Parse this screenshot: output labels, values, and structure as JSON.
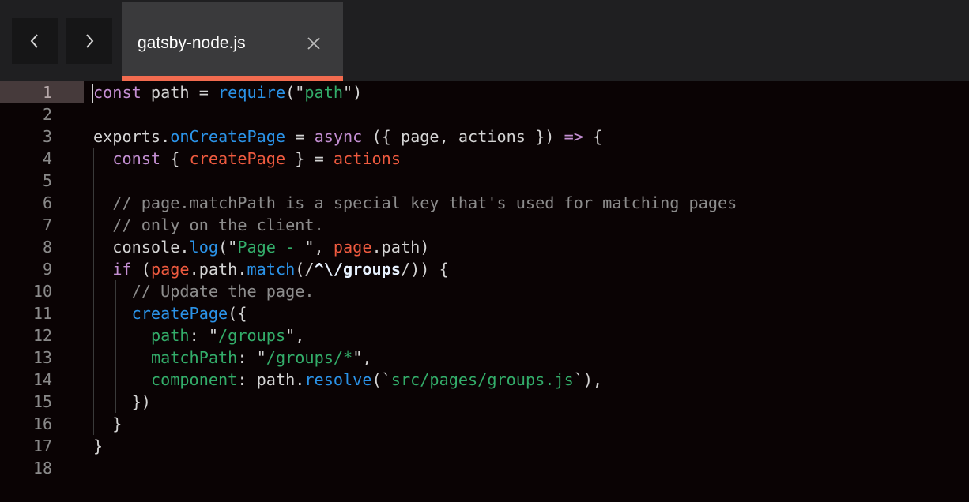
{
  "toolbar": {
    "back_icon": "chevron-left-icon",
    "forward_icon": "chevron-right-icon"
  },
  "tab": {
    "label": "gatsby-node.js",
    "close_icon": "close-icon",
    "accent_color": "#f26b4f"
  },
  "colors": {
    "keyword": "#c48fd3",
    "function": "#2b93e8",
    "string": "#33ad6a",
    "variable": "#ee5a3f",
    "comment": "#8d8d8d",
    "plain": "#d4d4d4"
  },
  "editor": {
    "current_line": 1,
    "lines": [
      {
        "num": "1",
        "tokens": [
          [
            "kw",
            "const"
          ],
          [
            "plain",
            " path = "
          ],
          [
            "fn",
            "require"
          ],
          [
            "plain",
            "(\""
          ],
          [
            "str",
            "path"
          ],
          [
            "plain",
            "\")"
          ]
        ]
      },
      {
        "num": "2",
        "tokens": []
      },
      {
        "num": "3",
        "tokens": [
          [
            "plain",
            "exports."
          ],
          [
            "fn",
            "onCreatePage"
          ],
          [
            "plain",
            " = "
          ],
          [
            "kw",
            "async"
          ],
          [
            "plain",
            " ({ page, actions }) "
          ],
          [
            "kw",
            "=>"
          ],
          [
            "plain",
            " {"
          ]
        ]
      },
      {
        "num": "4",
        "tokens": [
          [
            "plain",
            "  "
          ],
          [
            "kw",
            "const"
          ],
          [
            "plain",
            " { "
          ],
          [
            "var",
            "createPage"
          ],
          [
            "plain",
            " } = "
          ],
          [
            "var",
            "actions"
          ]
        ]
      },
      {
        "num": "5",
        "tokens": []
      },
      {
        "num": "6",
        "tokens": [
          [
            "plain",
            "  "
          ],
          [
            "cmt",
            "// page.matchPath is a special key that's used for matching pages"
          ]
        ]
      },
      {
        "num": "7",
        "tokens": [
          [
            "plain",
            "  "
          ],
          [
            "cmt",
            "// only on the client."
          ]
        ]
      },
      {
        "num": "8",
        "tokens": [
          [
            "plain",
            "  console."
          ],
          [
            "fn",
            "log"
          ],
          [
            "plain",
            "(\""
          ],
          [
            "str",
            "Page - "
          ],
          [
            "plain",
            "\", "
          ],
          [
            "var",
            "page"
          ],
          [
            "plain",
            ".path)"
          ]
        ]
      },
      {
        "num": "9",
        "tokens": [
          [
            "plain",
            "  "
          ],
          [
            "kw",
            "if"
          ],
          [
            "plain",
            " ("
          ],
          [
            "var",
            "page"
          ],
          [
            "plain",
            ".path."
          ],
          [
            "fn",
            "match"
          ],
          [
            "plain",
            "(/"
          ],
          [
            "rx",
            "^\\/groups"
          ],
          [
            "plain",
            "/)) {"
          ]
        ]
      },
      {
        "num": "10",
        "tokens": [
          [
            "plain",
            "    "
          ],
          [
            "cmt",
            "// Update the page."
          ]
        ]
      },
      {
        "num": "11",
        "tokens": [
          [
            "plain",
            "    "
          ],
          [
            "fn",
            "createPage"
          ],
          [
            "plain",
            "({"
          ]
        ]
      },
      {
        "num": "12",
        "tokens": [
          [
            "plain",
            "      "
          ],
          [
            "str",
            "path"
          ],
          [
            "plain",
            ": \""
          ],
          [
            "str",
            "/groups"
          ],
          [
            "plain",
            "\","
          ]
        ]
      },
      {
        "num": "13",
        "tokens": [
          [
            "plain",
            "      "
          ],
          [
            "str",
            "matchPath"
          ],
          [
            "plain",
            ": \""
          ],
          [
            "str",
            "/groups/*"
          ],
          [
            "plain",
            "\","
          ]
        ]
      },
      {
        "num": "14",
        "tokens": [
          [
            "plain",
            "      "
          ],
          [
            "str",
            "component"
          ],
          [
            "plain",
            ": path."
          ],
          [
            "fn",
            "resolve"
          ],
          [
            "plain",
            "(`"
          ],
          [
            "str",
            "src/pages/groups.js"
          ],
          [
            "plain",
            "`),"
          ]
        ]
      },
      {
        "num": "15",
        "tokens": [
          [
            "plain",
            "    })"
          ]
        ]
      },
      {
        "num": "16",
        "tokens": [
          [
            "plain",
            "  }"
          ]
        ]
      },
      {
        "num": "17",
        "tokens": [
          [
            "plain",
            "}"
          ]
        ]
      },
      {
        "num": "18",
        "tokens": []
      }
    ]
  }
}
